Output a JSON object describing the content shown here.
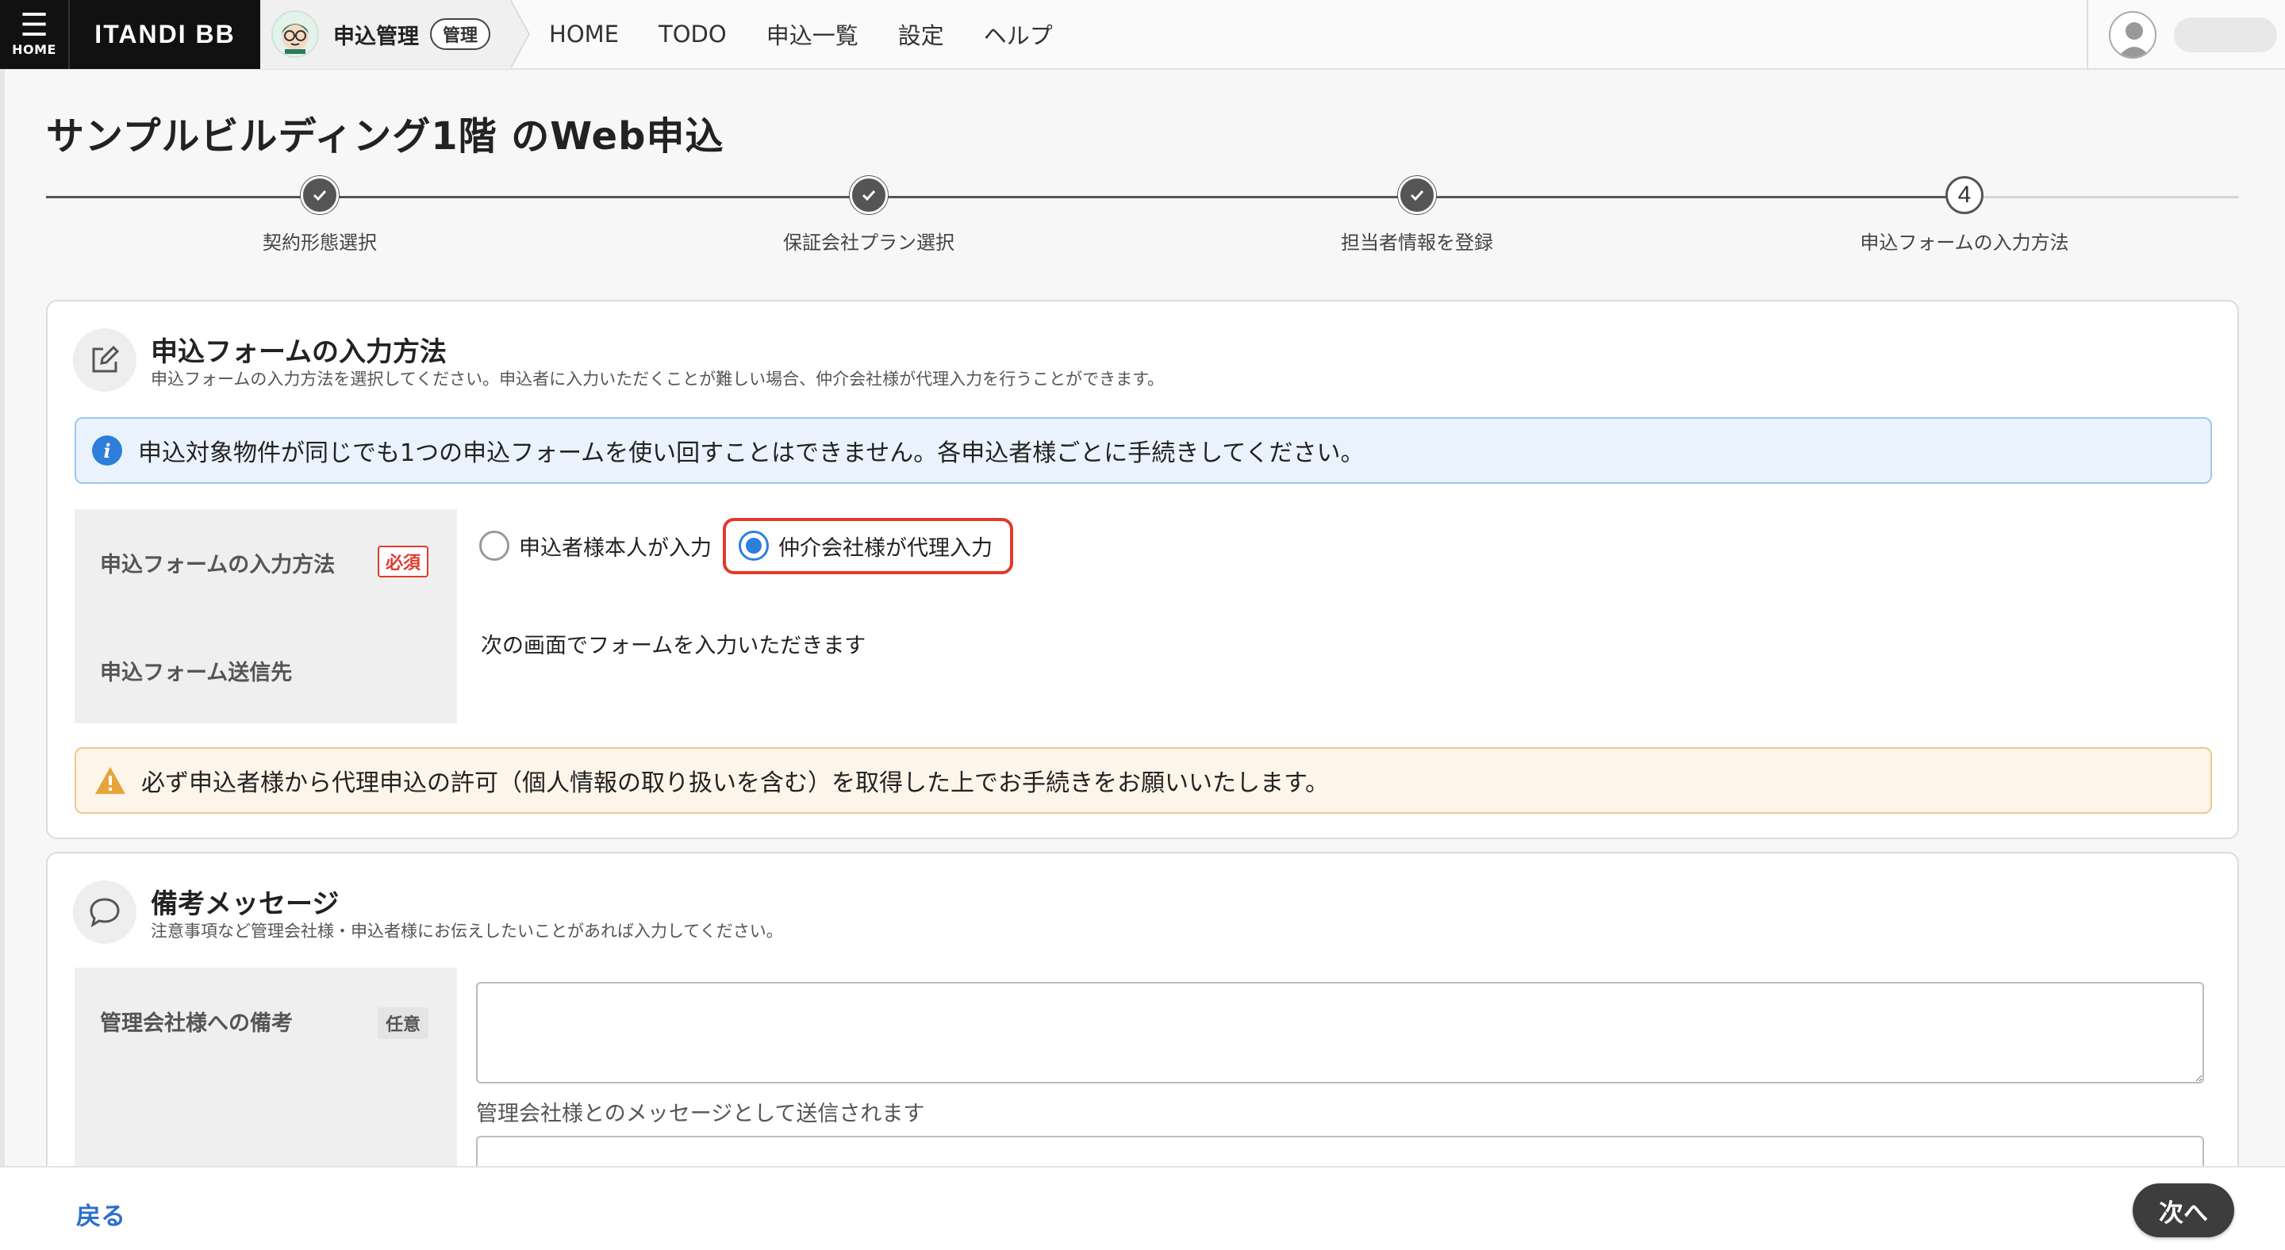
{
  "header": {
    "home_label": "HOME",
    "brand": "ITANDI BB",
    "app_name": "申込管理",
    "app_badge": "管理",
    "nav": [
      "HOME",
      "TODO",
      "申込一覧",
      "設定",
      "ヘルプ"
    ]
  },
  "page": {
    "title": "サンプルビルディング1階 のWeb申込"
  },
  "stepper": {
    "steps": [
      {
        "label": "契約形態選択",
        "status": "done"
      },
      {
        "label": "保証会社プラン選択",
        "status": "done"
      },
      {
        "label": "担当者情報を登録",
        "status": "done"
      },
      {
        "label": "申込フォームの入力方法",
        "status": "current",
        "number": "4"
      }
    ]
  },
  "input_method_card": {
    "title": "申込フォームの入力方法",
    "subtitle": "申込フォームの入力方法を選択してください。申込者に入力いただくことが難しい場合、仲介会社様が代理入力を行うことができます。",
    "info": "申込対象物件が同じでも1つの申込フォームを使い回すことはできません。各申込者様ごとに手続きしてください。",
    "field_label": "申込フォームの入力方法",
    "required_badge": "必須",
    "options": [
      {
        "label": "申込者様本人が入力",
        "selected": false
      },
      {
        "label": "仲介会社様が代理入力",
        "selected": true
      }
    ],
    "dest_label": "申込フォーム送信先",
    "dest_value": "次の画面でフォームを入力いただきます",
    "warning": "必ず申込者様から代理申込の許可（個人情報の取り扱いを含む）を取得した上でお手続きをお願いいたします。"
  },
  "remarks_card": {
    "title": "備考メッセージ",
    "subtitle": "注意事項など管理会社様・申込者様にお伝えしたいことがあれば入力してください。",
    "field_label": "管理会社様への備考",
    "optional_badge": "任意",
    "textarea_value": "",
    "hint": "管理会社様とのメッセージとして送信されます"
  },
  "footer": {
    "back": "戻る",
    "next": "次へ"
  },
  "colors": {
    "accent_blue": "#2d7fdb",
    "highlight_red": "#e33a2a",
    "dark": "#3d3d3d"
  }
}
